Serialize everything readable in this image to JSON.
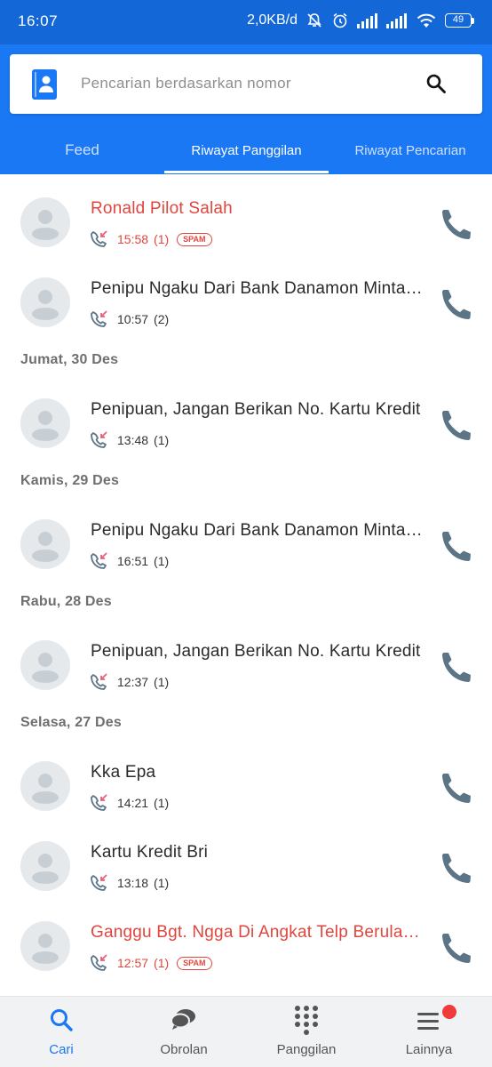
{
  "status_bar": {
    "time": "16:07",
    "network_speed": "2,0KB/d",
    "battery": "49",
    "icons": [
      "mute-icon",
      "alarm-icon",
      "signal-icon",
      "signal-icon",
      "wifi-icon",
      "battery-icon"
    ]
  },
  "search": {
    "placeholder": "Pencarian berdasarkan nomor",
    "left_icon": "contact-book-icon",
    "right_icon": "search-icon"
  },
  "tabs": [
    {
      "label": "Feed",
      "active": false
    },
    {
      "label": "Riwayat Panggilan",
      "active": true
    },
    {
      "label": "Riwayat Pencarian",
      "active": false
    }
  ],
  "sections": [
    {
      "date": "",
      "calls": [
        {
          "name": "Ronald Pilot Salah",
          "time": "15:58",
          "count": "(1)",
          "spam": true,
          "spam_label": "SPAM"
        },
        {
          "name": "Penipu Ngaku Dari Bank Danamon Minta Kode OTP",
          "time": "10:57",
          "count": "(2)",
          "spam": false,
          "spam_label": ""
        }
      ]
    },
    {
      "date": "Jumat, 30 Des",
      "calls": [
        {
          "name": "Penipuan, Jangan Berikan No. Kartu Kredit",
          "time": "13:48",
          "count": "(1)",
          "spam": false,
          "spam_label": ""
        }
      ]
    },
    {
      "date": "Kamis, 29 Des",
      "calls": [
        {
          "name": "Penipu Ngaku Dari Bank Danamon Minta Kode OTP",
          "time": "16:51",
          "count": "(1)",
          "spam": false,
          "spam_label": ""
        }
      ]
    },
    {
      "date": "Rabu, 28 Des",
      "calls": [
        {
          "name": "Penipuan, Jangan Berikan No. Kartu Kredit",
          "time": "12:37",
          "count": "(1)",
          "spam": false,
          "spam_label": ""
        }
      ]
    },
    {
      "date": "Selasa, 27 Des",
      "calls": [
        {
          "name": "Kka Epa",
          "time": "14:21",
          "count": "(1)",
          "spam": false,
          "spam_label": ""
        },
        {
          "name": "Kartu Kredit Bri",
          "time": "13:18",
          "count": "(1)",
          "spam": false,
          "spam_label": ""
        },
        {
          "name": "Ganggu Bgt. Ngga Di Angkat Telp Berulang Kali",
          "time": "12:57",
          "count": "(1)",
          "spam": true,
          "spam_label": "SPAM"
        }
      ]
    }
  ],
  "bottom_nav": [
    {
      "label": "Cari",
      "icon": "search-icon",
      "active": true
    },
    {
      "label": "Obrolan",
      "icon": "chat-icon",
      "active": false
    },
    {
      "label": "Panggilan",
      "icon": "dialpad-icon",
      "active": false
    },
    {
      "label": "Lainnya",
      "icon": "menu-icon",
      "active": false,
      "badge": true
    }
  ],
  "colors": {
    "status_bar": "#1367d6",
    "header": "#1a78f5",
    "spam": "#e0463e",
    "call_icon": "#5b7486",
    "missed_call_icon": "#ea5e78"
  }
}
